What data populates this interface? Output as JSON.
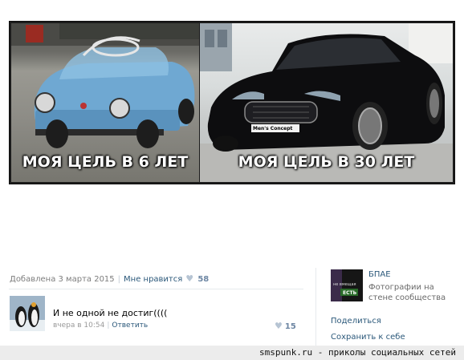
{
  "meme": {
    "left_caption": "МОЯ ЦЕЛЬ В 6 ЛЕТ",
    "right_caption": "МОЯ ЦЕЛЬ В 30 ЛЕТ",
    "plate_text": "Men's Concept"
  },
  "post": {
    "date": "Добавлена 3 марта 2015",
    "like_label": "Мне нравится",
    "like_count": "58"
  },
  "comment": {
    "text": "И не одной не достиг((((",
    "time": "вчера в 10:54",
    "reply_label": "Ответить",
    "likes": "15"
  },
  "group": {
    "name": "БПАЕ",
    "subtitle": "Фотографии на стене сообщества",
    "avatar_text_1": "не вмещая",
    "avatar_text_2": "ЕСТЬ"
  },
  "actions": {
    "share": "Поделиться",
    "save": "Сохранить к себе"
  },
  "footer": {
    "watermark": "smspunk.ru - приколы социальных сетей"
  }
}
